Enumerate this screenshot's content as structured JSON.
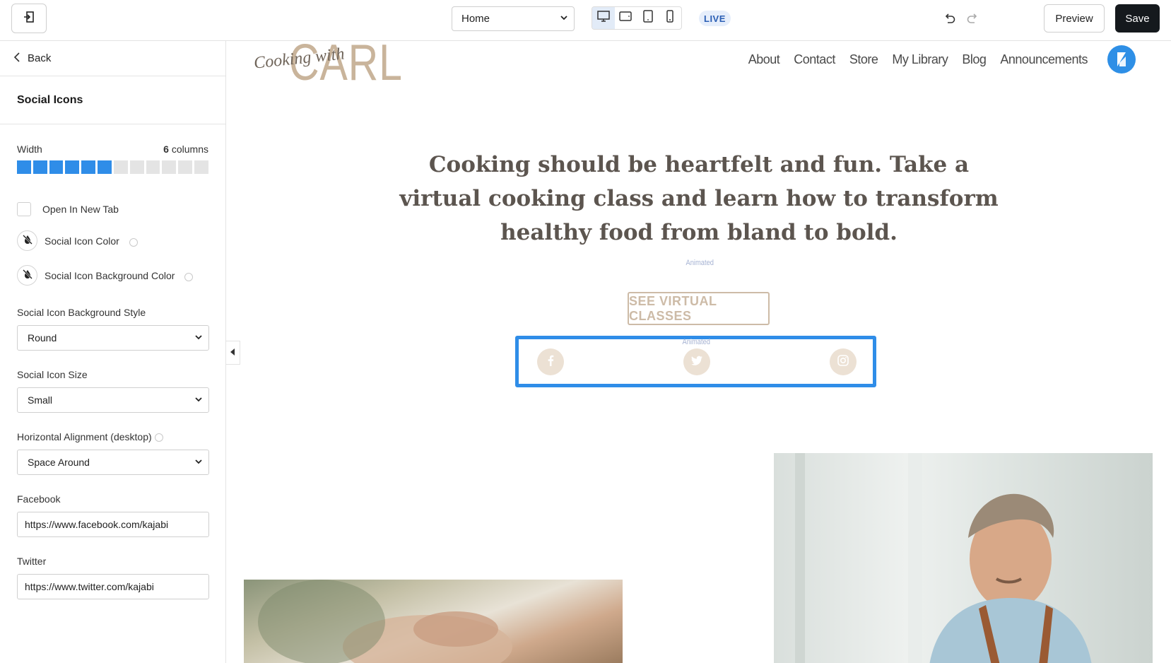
{
  "topbar": {
    "page_select_value": "Home",
    "live_badge": "LIVE",
    "preview_label": "Preview",
    "save_label": "Save"
  },
  "sidebar": {
    "back_label": "Back",
    "section_title": "Social Icons",
    "width_label": "Width",
    "width_value": "6",
    "width_unit": "columns",
    "width_total_columns": 12,
    "open_new_tab_label": "Open In New Tab",
    "open_new_tab_checked": false,
    "icon_color_label": "Social Icon Color",
    "icon_bg_color_label": "Social Icon Background Color",
    "bg_style_label": "Social Icon Background Style",
    "bg_style_value": "Round",
    "size_label": "Social Icon Size",
    "size_value": "Small",
    "alignment_label": "Horizontal Alignment (desktop)",
    "alignment_value": "Space Around",
    "facebook_label": "Facebook",
    "facebook_value": "https://www.facebook.com/kajabi",
    "twitter_label": "Twitter",
    "twitter_value": "https://www.twitter.com/kajabi"
  },
  "site": {
    "logo_script": "Cooking with",
    "logo_name": "CARL",
    "nav": [
      "About",
      "Contact",
      "Store",
      "My Library",
      "Blog",
      "Announcements"
    ],
    "hero_heading": "Cooking should be heartfelt and fun. Take a virtual cooking class and learn how to transform healthy food from bland to bold.",
    "animated_tag": "Animated",
    "cta_label": "SEE VIRTUAL CLASSES"
  },
  "colors": {
    "accent": "#2f8de8",
    "save_button": "#15191d",
    "brand_tan": "#c9b49b"
  },
  "icons": [
    "exit-icon",
    "desktop-icon",
    "tablet-landscape-icon",
    "tablet-portrait-icon",
    "mobile-icon",
    "undo-icon",
    "redo-icon",
    "chevron-left-icon",
    "no-color-icon",
    "info-icon",
    "facebook-icon",
    "twitter-icon",
    "instagram-icon"
  ]
}
